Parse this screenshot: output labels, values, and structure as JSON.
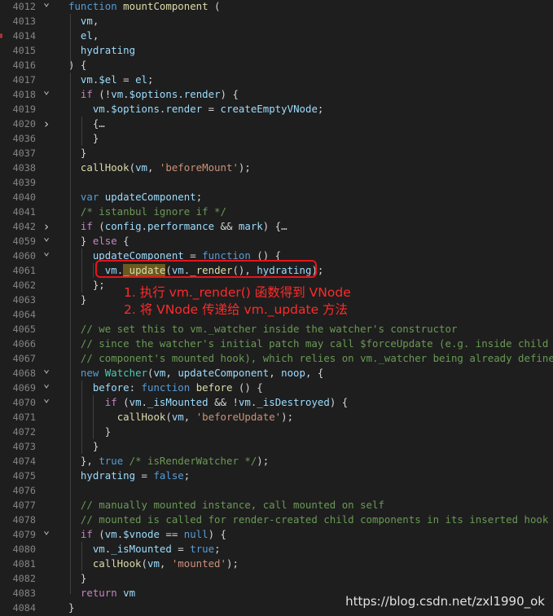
{
  "editor": {
    "lines": [
      {
        "num": "4012",
        "fold": "v"
      },
      {
        "num": "4013",
        "fold": ""
      },
      {
        "num": "4014",
        "fold": ""
      },
      {
        "num": "4015",
        "fold": ""
      },
      {
        "num": "4016",
        "fold": ""
      },
      {
        "num": "4017",
        "fold": ""
      },
      {
        "num": "4018",
        "fold": "v"
      },
      {
        "num": "4019",
        "fold": ""
      },
      {
        "num": "4020",
        "fold": ">"
      },
      {
        "num": "4036",
        "fold": ""
      },
      {
        "num": "4037",
        "fold": ""
      },
      {
        "num": "4038",
        "fold": ""
      },
      {
        "num": "4039",
        "fold": ""
      },
      {
        "num": "4040",
        "fold": ""
      },
      {
        "num": "4041",
        "fold": ""
      },
      {
        "num": "4042",
        "fold": ">"
      },
      {
        "num": "4059",
        "fold": "v"
      },
      {
        "num": "4060",
        "fold": "v"
      },
      {
        "num": "4061",
        "fold": ""
      },
      {
        "num": "4062",
        "fold": ""
      },
      {
        "num": "4063",
        "fold": ""
      },
      {
        "num": "4064",
        "fold": ""
      },
      {
        "num": "4065",
        "fold": ""
      },
      {
        "num": "4066",
        "fold": ""
      },
      {
        "num": "4067",
        "fold": ""
      },
      {
        "num": "4068",
        "fold": "v"
      },
      {
        "num": "4069",
        "fold": "v"
      },
      {
        "num": "4070",
        "fold": "v"
      },
      {
        "num": "4071",
        "fold": ""
      },
      {
        "num": "4072",
        "fold": ""
      },
      {
        "num": "4073",
        "fold": ""
      },
      {
        "num": "4074",
        "fold": ""
      },
      {
        "num": "4075",
        "fold": ""
      },
      {
        "num": "4076",
        "fold": ""
      },
      {
        "num": "4077",
        "fold": ""
      },
      {
        "num": "4078",
        "fold": ""
      },
      {
        "num": "4079",
        "fold": "v"
      },
      {
        "num": "4080",
        "fold": ""
      },
      {
        "num": "4081",
        "fold": ""
      },
      {
        "num": "4082",
        "fold": ""
      },
      {
        "num": "4083",
        "fold": ""
      },
      {
        "num": "4084",
        "fold": ""
      }
    ],
    "code": [
      "function mountComponent (",
      "  vm,",
      "  el,",
      "  hydrating",
      ") {",
      "  vm.$el = el;",
      "  if (!vm.$options.render) {",
      "    vm.$options.render = createEmptyVNode;",
      "    {…",
      "    }",
      "  }",
      "  callHook(vm, 'beforeMount');",
      "",
      "  var updateComponent;",
      "  /* istanbul ignore if */",
      "  if (config.performance && mark) {…",
      "  } else {",
      "    updateComponent = function () {",
      "      vm._update(vm._render(), hydrating);",
      "    };",
      "  }",
      "",
      "  // we set this to vm._watcher inside the watcher's constructor",
      "  // since the watcher's initial patch may call $forceUpdate (e.g. inside child",
      "  // component's mounted hook), which relies on vm._watcher being already defined",
      "  new Watcher(vm, updateComponent, noop, {",
      "    before: function before () {",
      "      if (vm._isMounted && !vm._isDestroyed) {",
      "        callHook(vm, 'beforeUpdate');",
      "      }",
      "    }",
      "  }, true /* isRenderWatcher */);",
      "  hydrating = false;",
      "",
      "  // manually mounted instance, call mounted on self",
      "  // mounted is called for render-created child components in its inserted hook",
      "  if (vm.$vnode == null) {",
      "    vm._isMounted = true;",
      "    callHook(vm, 'mounted');",
      "  }",
      "  return vm",
      "}"
    ]
  },
  "annotations": {
    "line1": "1. 执行 vm._render() 函数得到 VNode",
    "line2": "2. 将 VNode 传递给 vm._update 方法"
  },
  "watermark": "https://blog.csdn.net/zxl1990_ok",
  "colors": {
    "background": "#1e1e1e",
    "annotation_red": "#ff2a2a",
    "highlight_box": "#e8141b"
  }
}
